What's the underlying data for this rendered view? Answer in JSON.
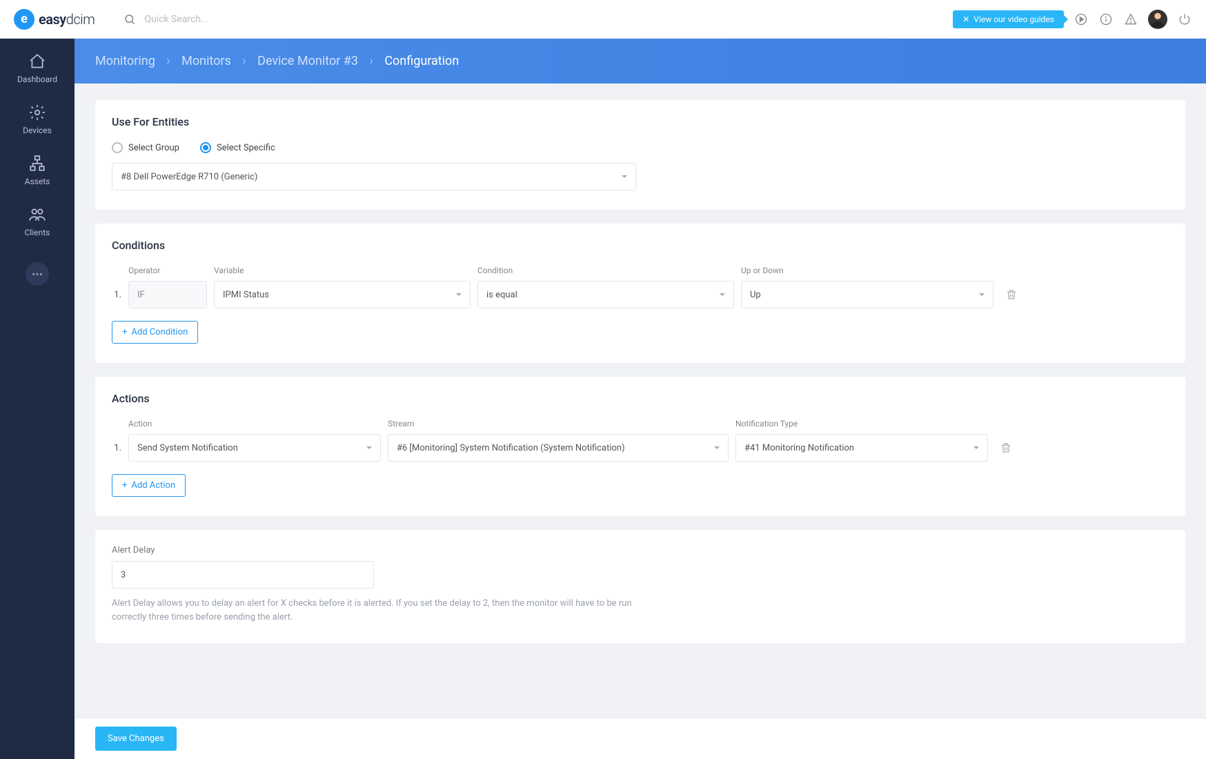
{
  "brand": {
    "name_a": "easy",
    "name_b": "dcim"
  },
  "search": {
    "placeholder": "Quick Search..."
  },
  "header": {
    "video_guides_label": "View our video guides"
  },
  "sidebar": {
    "items": [
      {
        "label": "Dashboard"
      },
      {
        "label": "Devices"
      },
      {
        "label": "Assets"
      },
      {
        "label": "Clients"
      }
    ]
  },
  "breadcrumb": {
    "items": [
      "Monitoring",
      "Monitors",
      "Device Monitor #3"
    ],
    "current": "Configuration"
  },
  "entities_card": {
    "title": "Use For Entities",
    "radio_group_label": "Select Group",
    "radio_specific_label": "Select Specific",
    "selected_entity": "#8 Dell PowerEdge R710 (Generic)"
  },
  "conditions_card": {
    "title": "Conditions",
    "headers": {
      "operator": "Operator",
      "variable": "Variable",
      "condition": "Condition",
      "updown": "Up or Down"
    },
    "rows": [
      {
        "num": "1.",
        "operator": "IF",
        "variable": "IPMI Status",
        "condition": "is equal",
        "updown": "Up"
      }
    ],
    "add_label": "Add Condition"
  },
  "actions_card": {
    "title": "Actions",
    "headers": {
      "action": "Action",
      "stream": "Stream",
      "notif": "Notification Type"
    },
    "rows": [
      {
        "num": "1.",
        "action": "Send System Notification",
        "stream": "#6 [Monitoring] System Notification (System Notification)",
        "notif": "#41 Monitoring Notification"
      }
    ],
    "add_label": "Add Action"
  },
  "alert_card": {
    "label": "Alert Delay",
    "value": "3",
    "help": "Alert Delay allows you to delay an alert for X checks before it is alerted. If you set the delay to 2, then the monitor will have to be run correctly three times before sending the alert."
  },
  "save_label": "Save Changes"
}
